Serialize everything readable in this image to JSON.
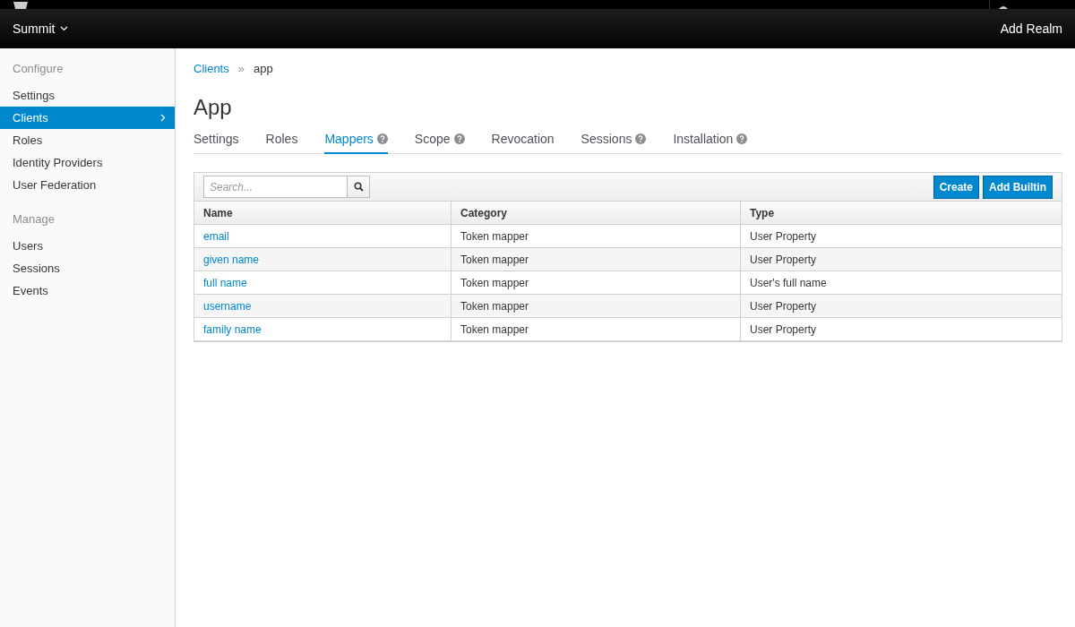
{
  "header": {
    "realm": "Summit",
    "add_realm": "Add Realm"
  },
  "sidebar": {
    "sections": [
      {
        "title": "Configure",
        "items": [
          {
            "label": "Settings",
            "selected": false
          },
          {
            "label": "Clients",
            "selected": true
          },
          {
            "label": "Roles",
            "selected": false
          },
          {
            "label": "Identity Providers",
            "selected": false
          },
          {
            "label": "User Federation",
            "selected": false
          }
        ]
      },
      {
        "title": "Manage",
        "items": [
          {
            "label": "Users",
            "selected": false
          },
          {
            "label": "Sessions",
            "selected": false
          },
          {
            "label": "Events",
            "selected": false
          }
        ]
      }
    ]
  },
  "breadcrumb": [
    {
      "label": "Clients",
      "kind": "link"
    },
    {
      "label": "»",
      "kind": "separator"
    },
    {
      "label": "app",
      "kind": "current"
    }
  ],
  "title": "App",
  "tabs": [
    {
      "label": "Settings",
      "selected": false,
      "help": false
    },
    {
      "label": "Roles",
      "selected": false,
      "help": false
    },
    {
      "label": "Mappers",
      "selected": true,
      "help": true
    },
    {
      "label": "Scope",
      "selected": false,
      "help": true
    },
    {
      "label": "Revocation",
      "selected": false,
      "help": false
    },
    {
      "label": "Sessions",
      "selected": false,
      "help": true
    },
    {
      "label": "Installation",
      "selected": false,
      "help": true
    }
  ],
  "toolbar": {
    "search": {
      "placeholder": "Search..."
    },
    "buttons": [
      "Create",
      "Add Builtin"
    ]
  },
  "table": {
    "columns": [
      "Name",
      "Category",
      "Type"
    ],
    "rows": [
      [
        "email",
        "Token mapper",
        "User Property"
      ],
      [
        "given name",
        "Token mapper",
        "User Property"
      ],
      [
        "full name",
        "Token mapper",
        "User's full name"
      ],
      [
        "username",
        "Token mapper",
        "User Property"
      ],
      [
        "family name",
        "Token mapper",
        "User Property"
      ]
    ]
  }
}
